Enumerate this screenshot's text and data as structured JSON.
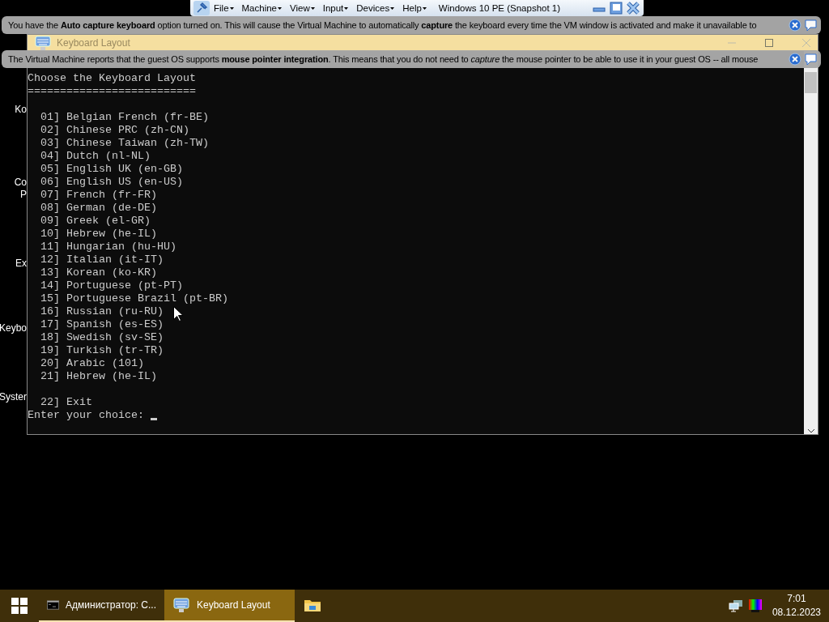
{
  "vm_toolbar": {
    "menus": [
      "File",
      "Machine",
      "View",
      "Input",
      "Devices",
      "Help"
    ],
    "title": "Windows 10 PE (Snapshot 1)"
  },
  "notifications": [
    {
      "text": "You have the **Auto capture keyboard** option turned on. This will cause the Virtual Machine to automatically **capture** the keyboard every time the VM window is activated and make it unavailable to"
    },
    {
      "text": "The Virtual Machine reports that the guest OS supports **mouse pointer integration**. This means that you do not need to *capture* the mouse pointer to be able to use it in your guest OS -- all mouse"
    }
  ],
  "desktop_icons": [
    {
      "lines": [
        "Ko"
      ]
    },
    {
      "lines": [
        "Co",
        "P"
      ]
    },
    {
      "lines": [
        "Ex"
      ]
    },
    {
      "lines": [
        "Keybo"
      ]
    },
    {
      "lines": [
        "Syster"
      ]
    }
  ],
  "console": {
    "title": "Keyboard Layout",
    "heading": "Choose the Keyboard Layout",
    "underline": "==========================",
    "options": [
      "01] Belgian French (fr-BE)",
      "02] Chinese PRC (zh-CN)",
      "03] Chinese Taiwan (zh-TW)",
      "04] Dutch (nl-NL)",
      "05] English UK (en-GB)",
      "06] English US (en-US)",
      "07] French (fr-FR)",
      "08] German (de-DE)",
      "09] Greek (el-GR)",
      "10] Hebrew (he-IL)",
      "11] Hungarian (hu-HU)",
      "12] Italian (it-IT)",
      "13] Korean (ko-KR)",
      "14] Portuguese (pt-PT)",
      "15] Portuguese Brazil (pt-BR)",
      "16] Russian (ru-RU)",
      "17] Spanish (es-ES)",
      "18] Swedish (sv-SE)",
      "19] Turkish (tr-TR)",
      "20] Arabic (101)",
      "21] Hebrew (he-IL)"
    ],
    "exit_option": "22] Exit",
    "prompt": "Enter your choice:"
  },
  "taskbar": {
    "tasks": [
      {
        "kind": "console",
        "label": "Администратор: C...",
        "selected": false
      },
      {
        "kind": "keyboard",
        "label": "Keyboard Layout",
        "selected": true
      },
      {
        "kind": "folder",
        "selected": false
      }
    ],
    "clock": {
      "time": "7:01",
      "date": "08.12.2023"
    }
  }
}
